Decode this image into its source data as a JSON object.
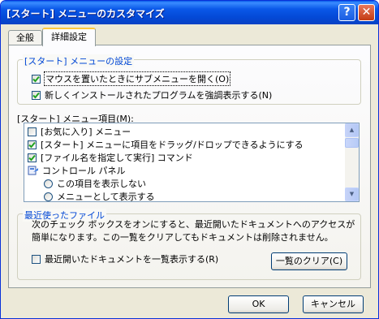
{
  "window": {
    "title": "[スタート] メニューのカスタマイズ",
    "help_label": "?",
    "close_label": "✕"
  },
  "tabs": [
    {
      "label": "全般",
      "selected": false
    },
    {
      "label": "詳細設定",
      "selected": true
    }
  ],
  "start_menu_settings": {
    "legend": "[スタート] メニューの設定",
    "options": [
      {
        "label": "マウスを置いたときにサブメニューを開く(O)",
        "checked": true
      },
      {
        "label": "新しくインストールされたプログラムを強調表示する(N)",
        "checked": true
      }
    ]
  },
  "start_menu_items": {
    "label": "[スタート] メニュー項目(M):",
    "items": [
      {
        "type": "checkbox",
        "label": "[お気に入り] メニュー",
        "checked": false
      },
      {
        "type": "checkbox",
        "label": "[スタート] メニューに項目をドラッグ/ドロップできるようにする",
        "checked": true
      },
      {
        "type": "checkbox",
        "label": "[ファイル名を指定して実行] コマンド",
        "checked": true
      },
      {
        "type": "heading",
        "label": "コントロール パネル",
        "icon": "control-panel-icon"
      },
      {
        "type": "radio",
        "label": "この項目を表示しない",
        "checked": false
      },
      {
        "type": "radio",
        "label": "メニューとして表示する",
        "checked": false
      }
    ]
  },
  "recent_files": {
    "legend": "最近使ったファイル",
    "description": "次のチェック ボックスをオンにすると、最近開いたドキュメントへのアクセスが簡単になります。この一覧をクリアしてもドキュメントは削除されません。",
    "list_recent_label": "最近開いたドキュメントを一覧表示する(R)",
    "list_recent_checked": false,
    "clear_button": "一覧のクリア(C)"
  },
  "footer": {
    "ok": "OK",
    "cancel": "キャンセル"
  },
  "colors": {
    "titlebar": "#0a58e8",
    "group_legend": "#0046d5",
    "check_mark": "#21a121"
  }
}
